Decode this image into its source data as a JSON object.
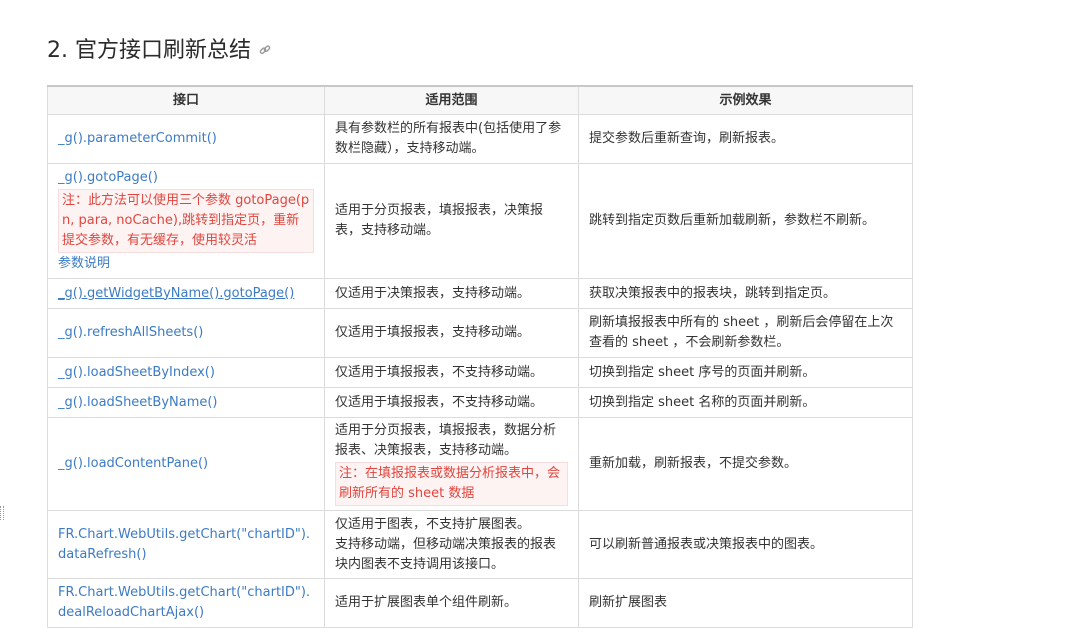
{
  "heading": "2. 官方接口刷新总结",
  "table": {
    "headers": [
      "接口",
      "适用范围",
      "示例效果"
    ],
    "rows": [
      {
        "api": "_g().parameterCommit()",
        "scope": "具有参数栏的所有报表中(包括使用了参数栏隐藏），支持移动端。",
        "effect": "提交参数后重新查询，刷新报表。"
      },
      {
        "api": "_g().gotoPage()",
        "api_note": "注：此方法可以使用三个参数 gotoPage(pn, para, noCache),跳转到指定页，重新提交参数，有无缓存，使用较灵活",
        "api_link": "参数说明",
        "scope": "适用于分页报表，填报报表，决策报表，支持移动端。",
        "effect": "跳转到指定页数后重新加载刷新，参数栏不刷新。"
      },
      {
        "api": "_g().getWidgetByName().gotoPage()",
        "scope": "仅适用于决策报表，支持移动端。",
        "effect": "获取决策报表中的报表块，跳转到指定页。"
      },
      {
        "api": "_g().refreshAllSheets()",
        "scope": "仅适用于填报报表，支持移动端。",
        "effect": "刷新填报报表中所有的 sheet ，刷新后会停留在上次查看的 sheet ，不会刷新参数栏。"
      },
      {
        "api": "_g().loadSheetByIndex()",
        "scope": "仅适用于填报报表，不支持移动端。",
        "effect": "切换到指定 sheet 序号的页面并刷新。"
      },
      {
        "api": "_g().loadSheetByName()",
        "scope": "仅适用于填报报表，不支持移动端。",
        "effect": "切换到指定 sheet 名称的页面并刷新。"
      },
      {
        "api": "_g().loadContentPane()",
        "scope": "适用于分页报表，填报报表，数据分析报表、决策报表，支持移动端。",
        "scope_note": "注：在填报报表或数据分析报表中，会刷新所有的 sheet 数据",
        "effect": "重新加载，刷新报表，不提交参数。"
      },
      {
        "api": "FR.Chart.WebUtils.getChart(\"chartID\").dataRefresh()",
        "scope": "仅适用于图表，不支持扩展图表。",
        "scope2": "支持移动端，但移动端决策报表的报表块内图表不支持调用该接口。",
        "effect": "可以刷新普通报表或决策报表中的图表。"
      },
      {
        "api": "FR.Chart.WebUtils.getChart(\"chartID\").dealReloadChartAjax()",
        "scope": "适用于扩展图表单个组件刷新。",
        "effect": "刷新扩展图表"
      }
    ]
  },
  "colors": {
    "link": "#3c7bc4",
    "note": "#e0463e",
    "header_bg": "#f7f7f7"
  },
  "icons": {
    "heading_anchor": "link-icon"
  }
}
